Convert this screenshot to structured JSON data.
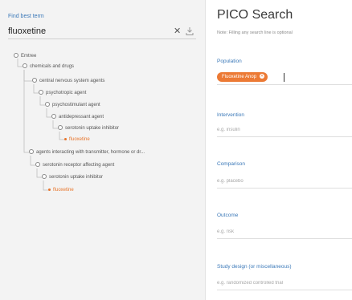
{
  "left_panel": {
    "find_label": "Find best term",
    "search_value": "fluoxetine",
    "clear_icon": "close-icon",
    "export_icon": "download-icon",
    "tree": [
      {
        "label": "Emtree",
        "type": "root"
      },
      {
        "label": "chemicals and drugs",
        "type": "node"
      },
      {
        "label": "central nervous system agents",
        "type": "node"
      },
      {
        "label": "psychotropic agent",
        "type": "node"
      },
      {
        "label": "psychostimulant agent",
        "type": "node"
      },
      {
        "label": "antidepressant agent",
        "type": "node"
      },
      {
        "label": "serotonin uptake inhibitor",
        "type": "node"
      },
      {
        "label": "fluoxetine",
        "type": "leaf"
      },
      {
        "label": "agents interacting with transmitter, hormone or dr...",
        "type": "node"
      },
      {
        "label": "serotonin receptor affecting agent",
        "type": "node"
      },
      {
        "label": "serotonin uptake inhibitor",
        "type": "node"
      },
      {
        "label": "fluoxetine",
        "type": "leaf"
      }
    ]
  },
  "right_panel": {
    "title": "PICO Search",
    "note": "Note: Filling any search line is optional",
    "fields": [
      {
        "label": "Population",
        "chip": "Fluoxetine Anop",
        "placeholder": "",
        "value": ""
      },
      {
        "label": "Intervention",
        "chip": "",
        "placeholder": "e.g. insulin",
        "value": ""
      },
      {
        "label": "Comparison",
        "chip": "",
        "placeholder": "e.g. placebo",
        "value": ""
      },
      {
        "label": "Outcome",
        "chip": "",
        "placeholder": "e.g. risk",
        "value": ""
      },
      {
        "label": "Study design (or miscellaneous)",
        "chip": "",
        "placeholder": "e.g. randomized controlled trial",
        "value": ""
      }
    ]
  },
  "colors": {
    "accent_blue": "#3a78b8",
    "highlight_orange": "#e8742a",
    "panel_bg": "#f3f3f3"
  }
}
